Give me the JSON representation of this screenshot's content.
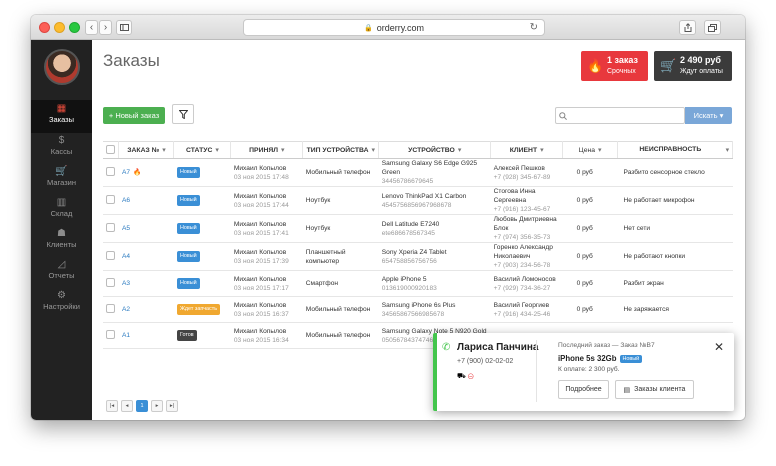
{
  "browser": {
    "url": "orderry.com",
    "nav_back": "‹",
    "nav_fwd": "›"
  },
  "sidebar": {
    "items": [
      {
        "label": "Заказы",
        "icon": "orders-icon",
        "glyph": "▦",
        "active": true
      },
      {
        "label": "Кассы",
        "icon": "cash-icon",
        "glyph": "$",
        "active": false
      },
      {
        "label": "Магазин",
        "icon": "cart-icon",
        "glyph": "🛒",
        "active": false
      },
      {
        "label": "Склад",
        "icon": "barcode-icon",
        "glyph": "▥",
        "active": false
      },
      {
        "label": "Клиенты",
        "icon": "users-icon",
        "glyph": "☗",
        "active": false
      },
      {
        "label": "Отчеты",
        "icon": "chart-icon",
        "glyph": "◿",
        "active": false
      },
      {
        "label": "Настройки",
        "icon": "gear-icon",
        "glyph": "⚙",
        "active": false
      }
    ]
  },
  "header": {
    "title": "Заказы",
    "urgent": {
      "count": "1 заказ",
      "label": "Срочных",
      "color": "#e8383d"
    },
    "awaiting": {
      "amount": "2 490 руб",
      "label": "Ждут оплаты",
      "color": "#3b3b3b"
    }
  },
  "toolbar": {
    "new_order": "+ Новый заказ",
    "search_placeholder": "",
    "search_button": "Искать ▾"
  },
  "table": {
    "columns": [
      "ЗАКАЗ №",
      "СТАТУС",
      "ПРИНЯЛ",
      "ТИП УСТРОЙСТВА",
      "УСТРОЙСТВО",
      "КЛИЕНТ",
      "Цена",
      "НЕИСПРАВНОСТЬ"
    ],
    "rows": [
      {
        "id": "A7",
        "urgent": true,
        "status": "Новый",
        "status_color": "#3a8fd6",
        "accepted_by": "Михаил Копылов",
        "accepted_at": "03 ноя 2015 17:48",
        "device_type": "Мобильный телефон",
        "device": "Samsung Galaxy S6 Edge G925 Green",
        "serial": "34456786679645",
        "client": "Алексей Пешков",
        "phone": "+7 (928) 345-67-89",
        "price": "0 руб",
        "issue": "Разбито сенсорное стекло"
      },
      {
        "id": "A6",
        "urgent": false,
        "status": "Новый",
        "status_color": "#3a8fd6",
        "accepted_by": "Михаил Копылов",
        "accepted_at": "03 ноя 2015 17:44",
        "device_type": "Ноутбук",
        "device": "Lenovo ThinkPad X1 Carbon",
        "serial": "4545756856967968678",
        "client": "Стогова Инна Сергеевна",
        "phone": "+7 (916) 123-45-67",
        "price": "0 руб",
        "issue": "Не работает микрофон"
      },
      {
        "id": "A5",
        "urgent": false,
        "status": "Новый",
        "status_color": "#3a8fd6",
        "accepted_by": "Михаил Копылов",
        "accepted_at": "03 ноя 2015 17:41",
        "device_type": "Ноутбук",
        "device": "Dell Latitude E7240",
        "serial": "ete686678567345",
        "client": "Любовь Дмитриевна Блок",
        "phone": "+7 (974) 356-35-73",
        "price": "0 руб",
        "issue": "Нет сети"
      },
      {
        "id": "A4",
        "urgent": false,
        "status": "Новый",
        "status_color": "#3a8fd6",
        "accepted_by": "Михаил Копылов",
        "accepted_at": "03 ноя 2015 17:39",
        "device_type": "Планшетный компьютер",
        "device": "Sony Xperia Z4 Tablet",
        "serial": "654758856756756",
        "client": "Горенко Александр Николаевич",
        "phone": "+7 (903) 234-56-78",
        "price": "0 руб",
        "issue": "Не работают кнопки"
      },
      {
        "id": "A3",
        "urgent": false,
        "status": "Новый",
        "status_color": "#3a8fd6",
        "accepted_by": "Михаил Копылов",
        "accepted_at": "03 ноя 2015 17:17",
        "device_type": "Смартфон",
        "device": "Apple iPhone 5",
        "serial": "013619000920183",
        "client": "Василий Ломоносов",
        "phone": "+7 (929) 734-36-27",
        "price": "0 руб",
        "issue": "Разбит экран"
      },
      {
        "id": "A2",
        "urgent": false,
        "status": "Ждет запчасть",
        "status_color": "#f0a830",
        "accepted_by": "Михаил Копылов",
        "accepted_at": "03 ноя 2015 16:37",
        "device_type": "Мобильный телефон",
        "device": "Samsung iPhone 6s Plus",
        "serial": "34565867566985678",
        "client": "Василий Георгиев",
        "phone": "+7 (916) 434-25-46",
        "price": "0 руб",
        "issue": "Не заряжается"
      },
      {
        "id": "A1",
        "urgent": false,
        "status": "Готов",
        "status_color": "#444444",
        "accepted_by": "Михаил Копылов",
        "accepted_at": "03 ноя 2015 16:34",
        "device_type": "Мобильный телефон",
        "device": "Samsung Galaxy Note 5 N920 Gold",
        "serial": "0505678437474655",
        "client": "",
        "phone": "",
        "price": "",
        "issue": ""
      }
    ]
  },
  "pagination": {
    "first": "|◂",
    "prev": "◂",
    "current": "1",
    "next": "▸",
    "last": "▸|"
  },
  "popup": {
    "name": "Лариса Панчина",
    "phone": "+7 (900) 02-02-02",
    "last_order": "Последний заказ — Заказ №B7",
    "device": "iPhone 5s 32Gb",
    "status": "Новый",
    "to_pay": "К оплате: 2 300 руб.",
    "details_button": "Подробнее",
    "client_orders_button": "Заказы клиента",
    "close": "✕"
  }
}
